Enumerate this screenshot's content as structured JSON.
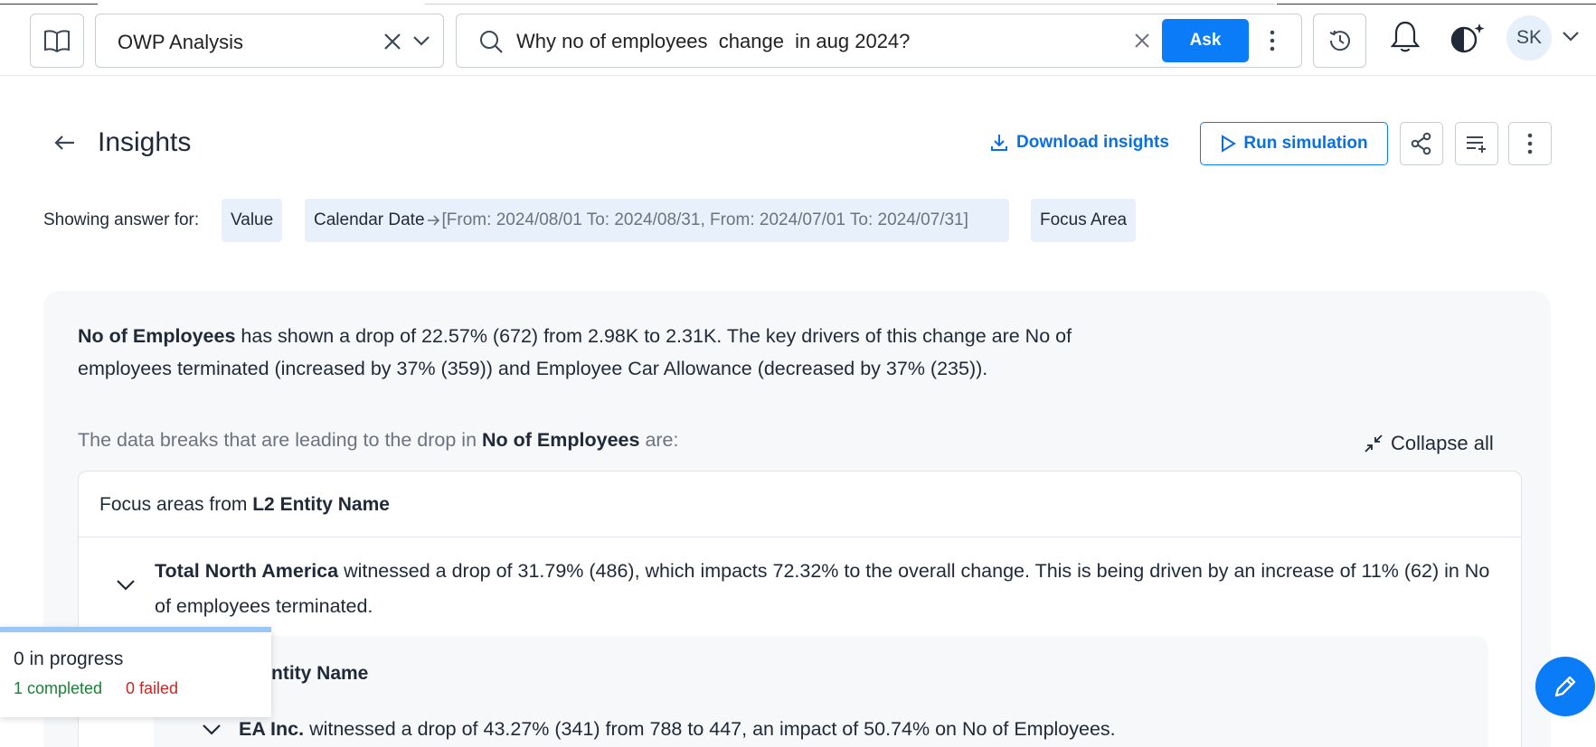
{
  "topbar": {
    "project_name": "OWP Analysis",
    "query": "Why no of employees  change  in aug 2024?",
    "ask_label": "Ask",
    "avatar_initials": "SK"
  },
  "header": {
    "title": "Insights",
    "download_label": "Download insights",
    "run_simulation_label": "Run simulation"
  },
  "filters": {
    "showing_label": "Showing answer for:",
    "chip_value": "Value",
    "chip_date_label": "Calendar Date",
    "chip_date_range": "[From: 2024/08/01 To: 2024/08/31, From: 2024/07/01 To: 2024/07/31]",
    "chip_focus": "Focus Area"
  },
  "summary": {
    "metric": "No of Employees",
    "text": " has shown a drop of 22.57% (672) from 2.98K to 2.31K. The key drivers of this change are No of employees terminated (increased by 37% (359)) and Employee Car Allowance (decreased by 37% (235))."
  },
  "breaks": {
    "prefix": "The data breaks that are leading to the drop in ",
    "metric": "No of Employees",
    "suffix": " are:",
    "collapse_label": "Collapse all"
  },
  "focus": {
    "prefix": "Focus areas from ",
    "dimension": "L2 Entity Name",
    "row": {
      "name": "Total North America",
      "text": " witnessed a drop of 31.79% (486), which impacts 72.32% to the overall change. This is being driven by an increase of 11% (62) in No of employees terminated."
    },
    "sub": {
      "heading": "Entity Name",
      "name": "EA Inc.",
      "text": " witnessed a drop of 43.27% (341) from 788 to 447, an impact of 50.74% on No of Employees."
    }
  },
  "toast": {
    "in_progress": "0 in progress",
    "completed": "1 completed",
    "failed": "0 failed"
  },
  "colors": {
    "accent": "#0a7cf7",
    "chip_bg": "#e7f0fb",
    "completed": "#1a7f37",
    "failed": "#c62828"
  }
}
